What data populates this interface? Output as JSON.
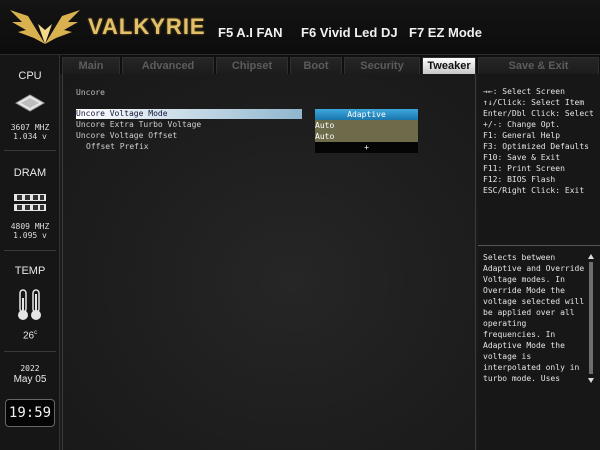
{
  "header": {
    "brand": "VALKYRIE",
    "buttons": [
      "F5 A.I FAN",
      "F6 Vivid Led DJ",
      "F7 EZ Mode"
    ]
  },
  "sidebar": {
    "cpu": {
      "title": "CPU",
      "freq": "3607 MHZ",
      "volt": "1.034 v"
    },
    "dram": {
      "title": "DRAM",
      "freq": "4809 MHZ",
      "volt": "1.095 v"
    },
    "temp": {
      "title": "TEMP",
      "value": "26",
      "unit": "c"
    },
    "date": {
      "year": "2022",
      "day": "May 05"
    },
    "clock": "19:59"
  },
  "tabs": [
    "Main",
    "Advanced",
    "Chipset",
    "Boot",
    "Security",
    "Tweaker",
    "Save & Exit"
  ],
  "active_tab": "Tweaker",
  "main": {
    "section": "Uncore",
    "items": [
      {
        "label": "Uncore Voltage Mode",
        "value": "Adaptive"
      },
      {
        "label": "Uncore Extra Turbo Voltage",
        "value": "Auto"
      },
      {
        "label": "Uncore Voltage Offset",
        "value": "Auto"
      },
      {
        "label": "Offset Prefix",
        "value": "+"
      }
    ]
  },
  "help": {
    "keys": [
      "→←: Select Screen",
      "↑↓/Click: Select Item",
      "Enter/Dbl Click: Select",
      "+/-: Change Opt.",
      "F1: General Help",
      "F3: Optimized Defaults",
      "F10: Save & Exit",
      "F11: Print Screen",
      "F12: BIOS Flash",
      "ESC/Right Click: Exit"
    ],
    "description": [
      "Selects between",
      "Adaptive and Override",
      "Voltage modes. In",
      "Override Mode the",
      "voltage selected will",
      "be applied over all",
      "operating",
      "frequencies. In",
      "Adaptive Mode the",
      "voltage is",
      "interpolated only in",
      "turbo mode. Uses"
    ]
  },
  "colors": {
    "brand_gold": "#e2c06a",
    "selected_value": "#2a8fc6",
    "auto_value": "#6d6b4a"
  }
}
